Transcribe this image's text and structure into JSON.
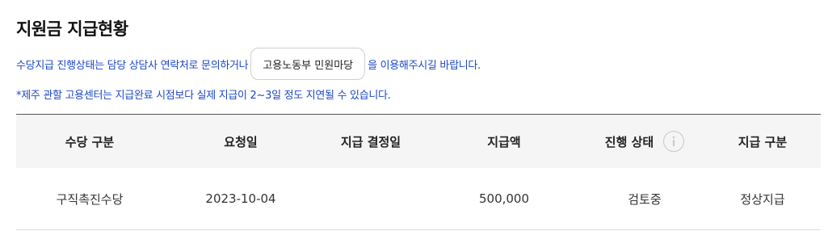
{
  "page": {
    "title": "지원금 지급현황"
  },
  "notice": {
    "line1_before": "수당지급 진행상태는 담당 상담사 연락처로 문의하거나",
    "link_button": "고용노동부 민원마당",
    "line1_after": "을 이용해주시길 바랍니다.",
    "line2": "*제주 관할 고용센터는 지급완료 시점보다 실제 지급이 2~3일 정도 지연될 수 있습니다."
  },
  "table": {
    "headers": {
      "type": "수당 구분",
      "request_date": "요청일",
      "decision_date": "지급 결정일",
      "amount": "지급액",
      "status": "진행 상태",
      "payment_type": "지급 구분"
    },
    "status_info_icon": "info-circle-icon",
    "rows": [
      {
        "type": "구직촉진수당",
        "request_date": "2023-10-04",
        "decision_date": "",
        "amount": "500,000",
        "status": "검토중",
        "payment_type": "정상지급"
      }
    ]
  },
  "colors": {
    "notice_text": "#1d48c8",
    "header_bg": "#f5f5f5",
    "top_border": "#555555",
    "row_border": "#dddddd"
  }
}
